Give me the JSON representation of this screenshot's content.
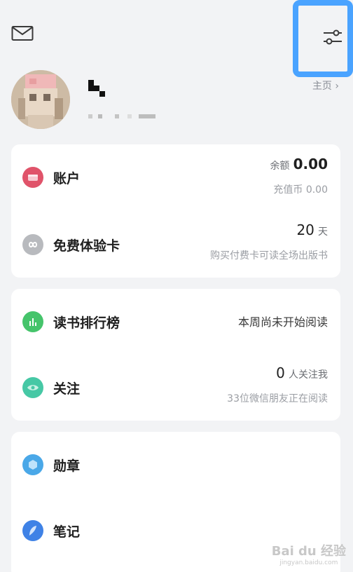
{
  "header": {
    "mail_icon": "mail-icon",
    "settings_icon": "settings-sliders-icon",
    "highlight_color": "#4aa3ff"
  },
  "profile": {
    "homepage_label": "主页"
  },
  "account_card": {
    "account": {
      "label": "账户",
      "icon": "wallet-icon",
      "icon_color": "#e0536a",
      "balance_label": "余额",
      "balance_value": "0.00",
      "coins_label": "充值币",
      "coins_value": "0.00"
    },
    "trial": {
      "label": "免费体验卡",
      "icon": "infinity-icon",
      "icon_color": "#b8babe",
      "days_value": "20",
      "days_unit": "天",
      "subtitle": "购买付费卡可读全场出版书"
    }
  },
  "social_card": {
    "ranking": {
      "label": "读书排行榜",
      "icon": "bar-chart-icon",
      "icon_color": "#45c46b",
      "status": "本周尚未开始阅读"
    },
    "follow": {
      "label": "关注",
      "icon": "eye-icon",
      "icon_color": "#46c8a5",
      "count_value": "0",
      "count_unit": "人关注我",
      "subtitle": "33位微信朋友正在阅读"
    }
  },
  "misc_card": {
    "badges": {
      "label": "勋章",
      "icon": "badge-icon",
      "icon_color": "#4aa8e8"
    },
    "notes": {
      "label": "笔记",
      "icon": "feather-icon",
      "icon_color": "#3f82e6"
    }
  },
  "watermark": {
    "text": "Bai du 经验",
    "sub": "jingyan.baidu.com"
  }
}
